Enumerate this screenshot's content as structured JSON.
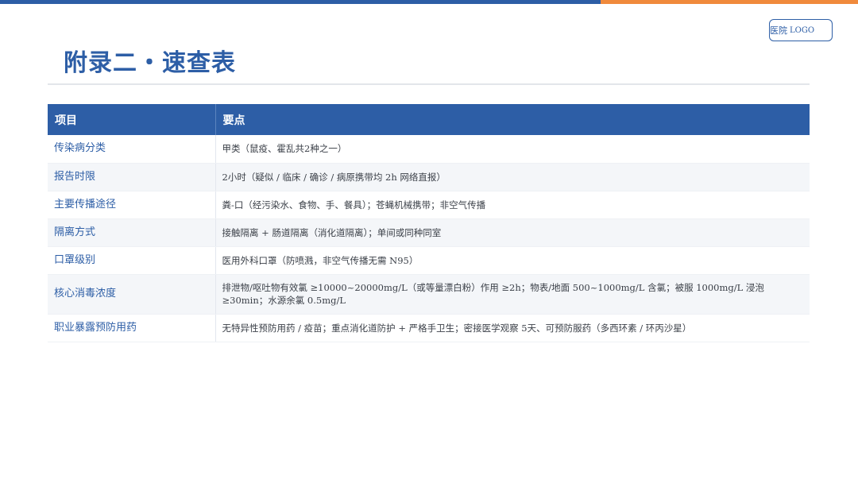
{
  "brand": {
    "logo_cn": "医院",
    "logo_en": "LOGO",
    "primary_color": "#2d5ea6",
    "accent_color": "#f08a3c"
  },
  "page": {
    "title": "附录二・速查表"
  },
  "table": {
    "headers": [
      "项目",
      "要点"
    ],
    "rows": [
      {
        "item": "传染病分类",
        "point": "甲类（鼠疫、霍乱共2种之一）"
      },
      {
        "item": "报告时限",
        "point": "2小时（疑似 / 临床 / 确诊 / 病原携带均 2h 网络直报）"
      },
      {
        "item": "主要传播途径",
        "point": "粪-口（经污染水、食物、手、餐具）；苍蝇机械携带；非空气传播"
      },
      {
        "item": "隔离方式",
        "point": "接触隔离 + 肠道隔离（消化道隔离）；单间或同种同室"
      },
      {
        "item": "口罩级别",
        "point": "医用外科口罩（防喷溅，非空气传播无需 N95）"
      },
      {
        "item": "核心消毒浓度",
        "point": "排泄物/呕吐物有效氯 ≥10000~20000mg/L（或等量漂白粉）作用 ≥2h；物表/地面 500~1000mg/L 含氯；被服 1000mg/L 浸泡 ≥30min；水源余氯 0.5mg/L"
      },
      {
        "item": "职业暴露预防用药",
        "point": "无特异性预防用药 / 疫苗；重点消化道防护 + 严格手卫生；密接医学观察 5天、可预防服药（多西环素 / 环丙沙星）"
      }
    ]
  }
}
